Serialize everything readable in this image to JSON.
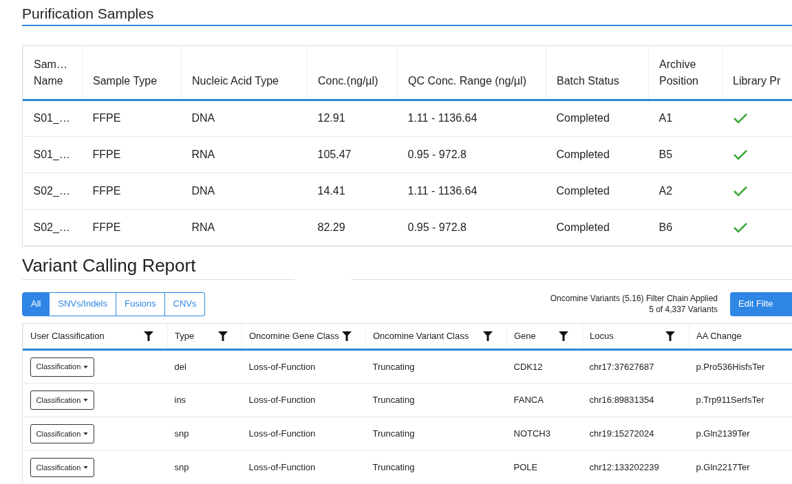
{
  "purification": {
    "title": "Purification Samples",
    "columns": [
      "Sam… Name",
      "Sample Type",
      "Nucleic Acid Type",
      "Conc.(ng/µl)",
      "QC Conc. Range (ng/µl)",
      "Batch Status",
      "Archive Position",
      "Library Pr"
    ],
    "rows": [
      {
        "cells": [
          "S01_…",
          "FFPE",
          "DNA",
          "12.91",
          "1.11 - 1136.64",
          "Completed",
          "A1"
        ],
        "library_prep_checked": true
      },
      {
        "cells": [
          "S01_…",
          "FFPE",
          "RNA",
          "105.47",
          "0.95 - 972.8",
          "Completed",
          "B5"
        ],
        "library_prep_checked": true
      },
      {
        "cells": [
          "S02_…",
          "FFPE",
          "DNA",
          "14.41",
          "1.11 - 1136.64",
          "Completed",
          "A2"
        ],
        "library_prep_checked": true
      },
      {
        "cells": [
          "S02_…",
          "FFPE",
          "RNA",
          "82.29",
          "0.95 - 972.8",
          "Completed",
          "B6"
        ],
        "library_prep_checked": true
      }
    ]
  },
  "variant_report": {
    "title": "Variant Calling Report",
    "tabs": [
      {
        "label": "All",
        "selected": true
      },
      {
        "label": "SNVs/Indels",
        "selected": false
      },
      {
        "label": "Fusions",
        "selected": false
      },
      {
        "label": "CNVs",
        "selected": false
      }
    ],
    "filter_chain": "Oncomine Variants (5.16) Filter Chain Applied",
    "variant_count": "5 of 4,337 Variants",
    "edit_button": "Edit Filte",
    "columns": [
      {
        "label": "User Classification",
        "filterable": true
      },
      {
        "label": "Type",
        "filterable": true
      },
      {
        "label": "Oncomine Gene Class",
        "filterable": true
      },
      {
        "label": "Oncomine Variant Class",
        "filterable": true
      },
      {
        "label": "Gene",
        "filterable": true
      },
      {
        "label": "Locus",
        "filterable": true
      },
      {
        "label": "AA Change",
        "filterable": false
      }
    ],
    "rows": [
      {
        "cells": [
          "Classification",
          "del",
          "Loss-of-Function",
          "Truncating",
          "CDK12",
          "chr17:37627687",
          "p.Pro536HisfsTer"
        ]
      },
      {
        "cells": [
          "Classification",
          "ins",
          "Loss-of-Function",
          "Truncating",
          "FANCA",
          "chr16:89831354",
          "p.Trp911SerfsTer"
        ]
      },
      {
        "cells": [
          "Classification",
          "snp",
          "Loss-of-Function",
          "Truncating",
          "NOTCH3",
          "chr19:15272024",
          "p.Gln2139Ter"
        ]
      },
      {
        "cells": [
          "Classification",
          "snp",
          "Loss-of-Function",
          "Truncating",
          "POLE",
          "chr12:133202239",
          "p.Gln2217Ter"
        ]
      }
    ]
  }
}
